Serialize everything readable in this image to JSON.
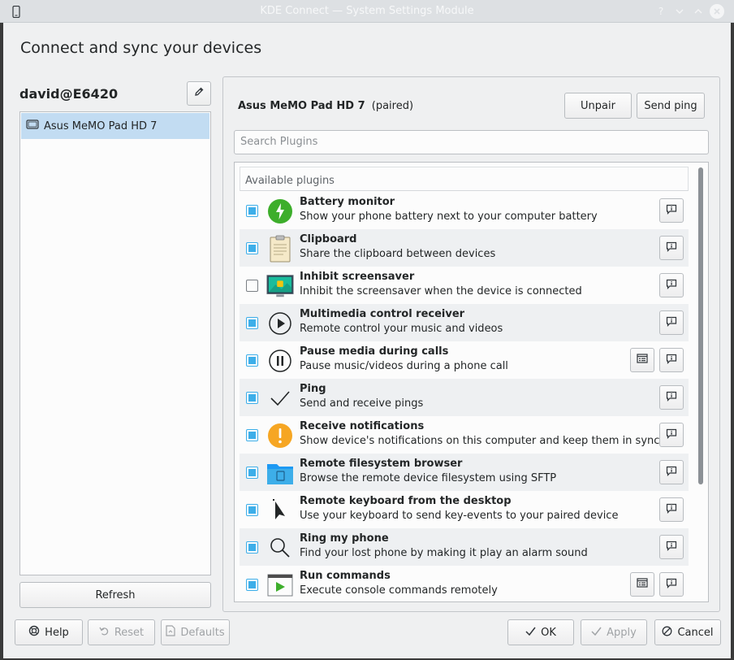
{
  "window": {
    "title": "KDE Connect — System Settings Module"
  },
  "heading": "Connect and sync your devices",
  "sidebar": {
    "hostname": "david@E6420",
    "devices": [
      {
        "label": "Asus MeMO Pad HD 7",
        "icon": "tablet-icon"
      }
    ],
    "refresh_label": "Refresh"
  },
  "device": {
    "name": "Asus MeMO Pad HD 7",
    "status": "(paired)",
    "unpair_label": "Unpair",
    "ping_label": "Send ping"
  },
  "search": {
    "placeholder": "Search Plugins"
  },
  "plugins": {
    "header": "Available plugins",
    "items": [
      {
        "name": "Battery monitor",
        "desc": "Show your phone battery next to your computer battery",
        "enabled": true,
        "icon": "battery-icon",
        "configurable": false
      },
      {
        "name": "Clipboard",
        "desc": "Share the clipboard between devices",
        "enabled": true,
        "icon": "clipboard-icon",
        "configurable": false
      },
      {
        "name": "Inhibit screensaver",
        "desc": "Inhibit the screensaver when the device is connected",
        "enabled": false,
        "icon": "screensaver-icon",
        "configurable": false
      },
      {
        "name": "Multimedia control receiver",
        "desc": "Remote control your music and videos",
        "enabled": true,
        "icon": "play-icon",
        "configurable": false
      },
      {
        "name": "Pause media during calls",
        "desc": "Pause music/videos during a phone call",
        "enabled": true,
        "icon": "pause-icon",
        "configurable": true
      },
      {
        "name": "Ping",
        "desc": "Send and receive pings",
        "enabled": true,
        "icon": "checkmark-icon",
        "configurable": false
      },
      {
        "name": "Receive notifications",
        "desc": "Show device's notifications on this computer and keep them in sync",
        "enabled": true,
        "icon": "notification-icon",
        "configurable": false
      },
      {
        "name": "Remote filesystem browser",
        "desc": "Browse the remote device filesystem using SFTP",
        "enabled": true,
        "icon": "folder-icon",
        "configurable": false
      },
      {
        "name": "Remote keyboard from the desktop",
        "desc": "Use your keyboard to send key-events to your paired device",
        "enabled": true,
        "icon": "pointer-icon",
        "configurable": false
      },
      {
        "name": "Ring my phone",
        "desc": "Find your lost phone by making it play an alarm sound",
        "enabled": true,
        "icon": "magnifier-icon",
        "configurable": false
      },
      {
        "name": "Run commands",
        "desc": "Execute console commands remotely",
        "enabled": true,
        "icon": "run-command-icon",
        "configurable": true
      }
    ]
  },
  "footer": {
    "help_label": "Help",
    "reset_label": "Reset",
    "defaults_label": "Defaults",
    "ok_label": "OK",
    "apply_label": "Apply",
    "cancel_label": "Cancel"
  },
  "colors": {
    "accent": "#3daee9",
    "selection": "#c2dcf2",
    "window_bg": "#eff0f1"
  }
}
